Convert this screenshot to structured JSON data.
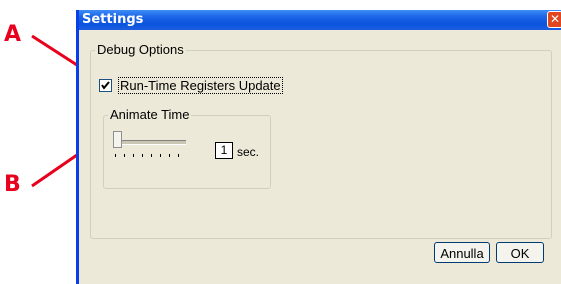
{
  "annotations": {
    "a": "A",
    "b": "B"
  },
  "colors": {
    "callout": "#e8001c",
    "titlebar": "#0b54dd",
    "dialog_bg": "#ece9d8"
  },
  "window": {
    "title": "Settings",
    "close_icon": "close-icon"
  },
  "debug_group": {
    "legend": "Debug Options",
    "checkbox": {
      "label": "Run-Time Registers Update",
      "checked": true
    }
  },
  "animate_group": {
    "legend": "Animate Time",
    "slider_value": 1,
    "value": "1",
    "unit": "sec."
  },
  "buttons": {
    "cancel": "Annulla",
    "ok": "OK"
  }
}
